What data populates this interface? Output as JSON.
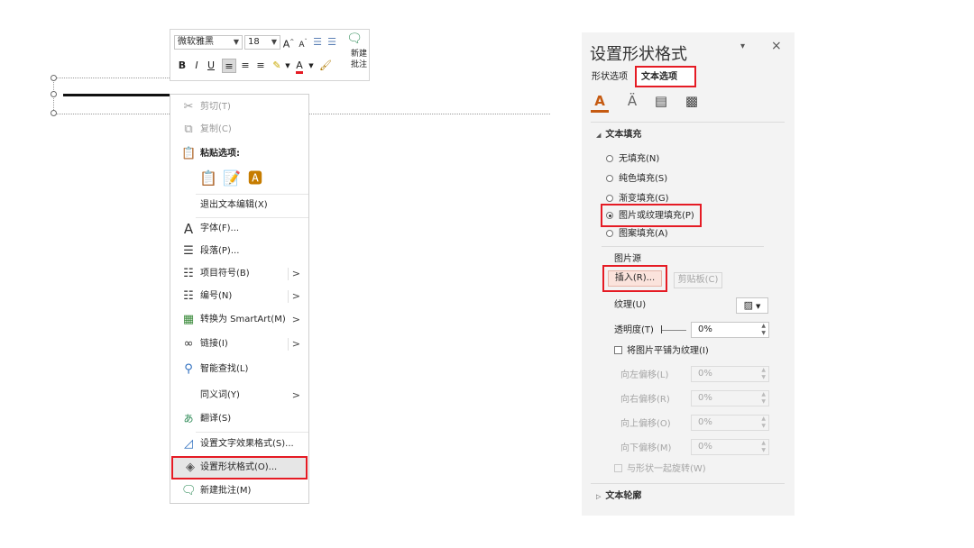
{
  "toolbar": {
    "font_name": "微软雅黑",
    "font_size": "18",
    "grow_font": "A",
    "shrink_font": "A",
    "new_comment_line1": "新建",
    "new_comment_line2": "批注",
    "bold": "B",
    "italic": "I",
    "underline": "U",
    "font_color": "A"
  },
  "context_menu": {
    "items": [
      {
        "label": "剪切(T)",
        "icon": "scissors-icon",
        "disabled": true
      },
      {
        "label": "复制(C)",
        "icon": "copy-icon",
        "disabled": true
      },
      {
        "label": "粘贴选项:",
        "icon": "paste-icon"
      },
      {
        "label": "退出文本编辑(X)"
      },
      {
        "label": "字体(F)...",
        "icon": "font-icon"
      },
      {
        "label": "段落(P)...",
        "icon": "paragraph-icon"
      },
      {
        "label": "项目符号(B)",
        "icon": "bullets-icon",
        "submenu": true
      },
      {
        "label": "编号(N)",
        "icon": "numbering-icon",
        "submenu": true
      },
      {
        "label": "转换为 SmartArt(M)",
        "icon": "smartart-icon",
        "submenu": true
      },
      {
        "label": "链接(I)",
        "icon": "link-icon",
        "submenu": true
      },
      {
        "label": "智能查找(L)",
        "icon": "search-icon"
      },
      {
        "label": "同义词(Y)",
        "submenu": true
      },
      {
        "label": "翻译(S)",
        "icon": "translate-icon"
      },
      {
        "label": "设置文字效果格式(S)...",
        "icon": "text-effects-icon"
      },
      {
        "label": "设置形状格式(O)...",
        "icon": "shape-format-icon",
        "highlighted": true
      },
      {
        "label": "新建批注(M)",
        "icon": "comment-icon"
      }
    ],
    "submenu_arrow": ">"
  },
  "pane": {
    "title": "设置形状格式",
    "dropdown_glyph": "▾",
    "close_glyph": "×",
    "tabs": [
      "形状选项",
      "文本选项"
    ],
    "active_tab": "文本选项",
    "icon_tabs": [
      "text-fill-outline-icon",
      "text-effects-icon",
      "textbox-icon",
      "picture-icon"
    ],
    "text_fill": {
      "heading": "文本填充",
      "options": [
        "无填充(N)",
        "纯色填充(S)",
        "渐变填充(G)",
        "图片或纹理填充(P)",
        "图案填充(A)"
      ],
      "selected": "图片或纹理填充(P)"
    },
    "picture_source": {
      "label": "图片源",
      "insert_button": "插入(R)...",
      "clipboard_button": "剪贴板(C)"
    },
    "texture_label": "纹理(U)",
    "transparency_label": "透明度(T)",
    "transparency_value": "0%",
    "tile_checkbox": "将图片平铺为纹理(I)",
    "offsets": [
      {
        "label": "向左偏移(L)",
        "value": "0%"
      },
      {
        "label": "向右偏移(R)",
        "value": "0%"
      },
      {
        "label": "向上偏移(O)",
        "value": "0%"
      },
      {
        "label": "向下偏移(M)",
        "value": "0%"
      }
    ],
    "rotate_checkbox": "与形状一起旋转(W)",
    "text_outline": {
      "heading": "文本轮廓"
    }
  },
  "colors": {
    "highlight_border": "#e51b24",
    "accent": "#c55a11",
    "pane_bg": "#f3f3f3"
  }
}
